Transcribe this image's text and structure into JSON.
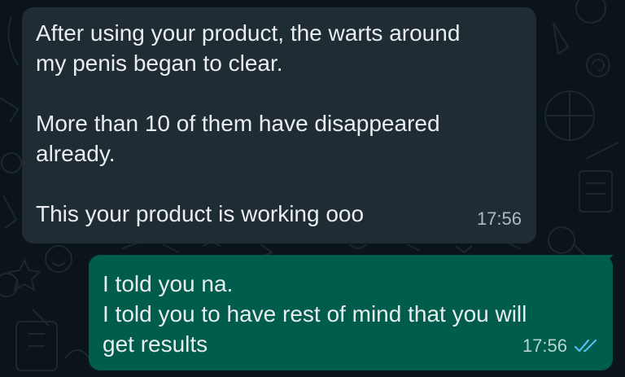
{
  "incoming_message": {
    "lines": [
      "After using your product, the warts around",
      "my penis began to clear.",
      "",
      "More than 10 of them have disappeared",
      "already.",
      "",
      "This your product is working ooo"
    ],
    "time": "17:56"
  },
  "outgoing_message": {
    "lines": [
      "I told you na.",
      "I told you to have rest of mind that you will",
      "get results"
    ],
    "time": "17:56",
    "status_icon": "double-check-read-icon",
    "status_color": "#53bdeb"
  },
  "colors": {
    "background": "#0b141a",
    "incoming_bubble": "#1f2c34",
    "outgoing_bubble": "#005c4b",
    "text": "#e9edef"
  }
}
